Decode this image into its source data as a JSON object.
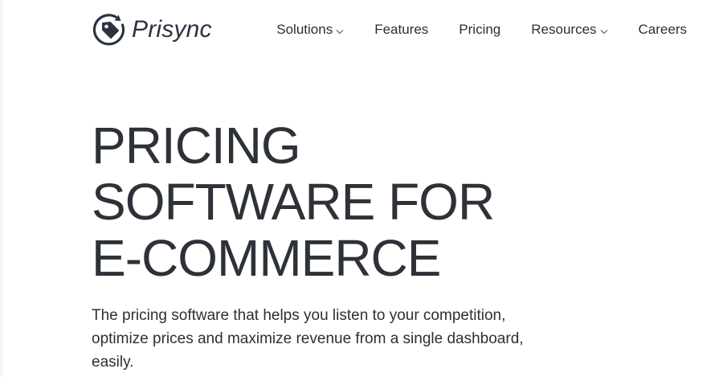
{
  "brand": {
    "name": "Prisync",
    "color": "#2b3340",
    "logo_icon": "price-tag-circle-icon"
  },
  "nav": {
    "items": [
      {
        "label": "Solutions",
        "has_dropdown": true
      },
      {
        "label": "Features",
        "has_dropdown": false
      },
      {
        "label": "Pricing",
        "has_dropdown": false
      },
      {
        "label": "Resources",
        "has_dropdown": true
      },
      {
        "label": "Careers",
        "has_dropdown": false
      }
    ]
  },
  "hero": {
    "title_lines": [
      "PRICING",
      "SOFTWARE FOR",
      "E-COMMERCE"
    ],
    "subtitle": "The pricing software that helps you listen to your competition, optimize prices and maximize revenue from a single dashboard, easily."
  },
  "colors": {
    "text": "#2b2f36",
    "background": "#ffffff"
  }
}
